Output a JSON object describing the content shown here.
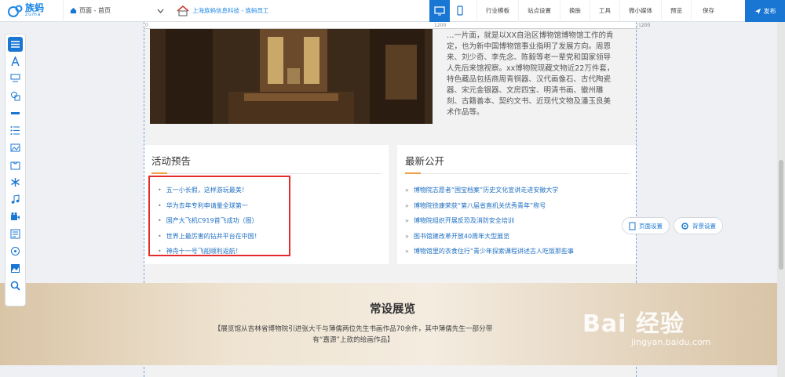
{
  "brand": {
    "name": "族蚂",
    "sub": "zuma"
  },
  "page_select": {
    "label": "页面 - 首页"
  },
  "site": {
    "label": "上海族蚂信息科技 - 族蚂员工"
  },
  "menu": [
    "行业模板",
    "站点设置",
    "换肤",
    "工具",
    "微小媒体",
    "预览",
    "保存"
  ],
  "publish": "发布",
  "ruler": {
    "left": "0",
    "mid": "1200",
    "mid2": "/1200"
  },
  "intro": "…一片面，就是以XX自治区博物馆博物馆工作的肯定，也为新中国博物馆事业指明了发展方向。周恩来、刘少奇、李先念、陈毅等老一辈党和国家领导人先后来馆视察。xx博物院现藏文物近22万件套，特色藏品包括商周青铜器、汉代画像石、古代陶瓷器、宋元金银器、文房四宝、明清书画、徽州雕刻、古籍善本、契约文书、近现代文物及潘玉良美术作品等。",
  "activities": {
    "title": "活动预告",
    "items": [
      "五一小长假，这样游玩最美！",
      "华为去年专利申请量全球第一",
      "国产大飞机C919首飞成功（图）",
      "世界上最厉害的钻井平台在中国！",
      "神舟十一号飞船顺利返航！"
    ]
  },
  "news": {
    "title": "最新公开",
    "items": [
      "博物院志愿者“国宝档案”历史文化宣讲走进安徽大学",
      "博物院徐康荣获“第八届省直机关优秀青年”称号",
      "博物院组织开展反恐及消防安全培训",
      "图书馆建改革开放40周年大型展览",
      "博物馆里的衣食住行“青少年探索课程讲述古人吃饭那些事"
    ]
  },
  "float": {
    "page_settings": "页面设置",
    "bg_settings": "背景设置"
  },
  "banner": {
    "title": "常设展览",
    "desc": "【展览馆从吉林省博物院引进张大千与薄儒两位先生书画作品70余件，其中薄儒先生一部分带有“嘉源”上款的绘画作品】"
  },
  "watermark": {
    "big": "Bai 经验",
    "small": "jingyan.baidu.com"
  },
  "colors": {
    "accent": "#1976d2",
    "highlight": "#e52b2b"
  }
}
